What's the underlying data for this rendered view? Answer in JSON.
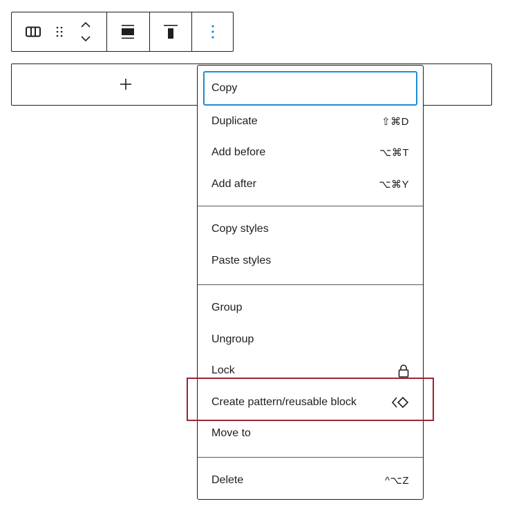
{
  "toolbar": {
    "buttons": [
      {
        "name": "columns-block-icon",
        "label": "Columns"
      },
      {
        "name": "drag-handle-icon",
        "label": "Drag"
      },
      {
        "name": "move-up-down-icon",
        "label": "Move up/down"
      },
      {
        "name": "align-icon",
        "label": "Align"
      },
      {
        "name": "vertical-align-top-icon",
        "label": "Change vertical alignment"
      },
      {
        "name": "more-options-icon",
        "label": "Options"
      }
    ],
    "accent_color": "#1e8ad6"
  },
  "block": {
    "appender_label": "+"
  },
  "menu": {
    "sections": [
      {
        "items": [
          {
            "label": "Copy",
            "shortcut": ""
          },
          {
            "label": "Duplicate",
            "shortcut": "⇧⌘D"
          },
          {
            "label": "Add before",
            "shortcut": "⌥⌘T"
          },
          {
            "label": "Add after",
            "shortcut": "⌥⌘Y"
          }
        ]
      },
      {
        "items": [
          {
            "label": "Copy styles",
            "shortcut": ""
          },
          {
            "label": "Paste styles",
            "shortcut": ""
          }
        ]
      },
      {
        "items": [
          {
            "label": "Group",
            "shortcut": ""
          },
          {
            "label": "Ungroup",
            "shortcut": ""
          },
          {
            "label": "Lock",
            "icon": "lock-icon"
          },
          {
            "label": "Create pattern/reusable block",
            "icon": "pattern-icon"
          },
          {
            "label": "Move to",
            "shortcut": ""
          }
        ]
      },
      {
        "items": [
          {
            "label": "Delete",
            "shortcut": "^⌥Z"
          }
        ]
      }
    ],
    "highlight_color": "#9b2235"
  }
}
